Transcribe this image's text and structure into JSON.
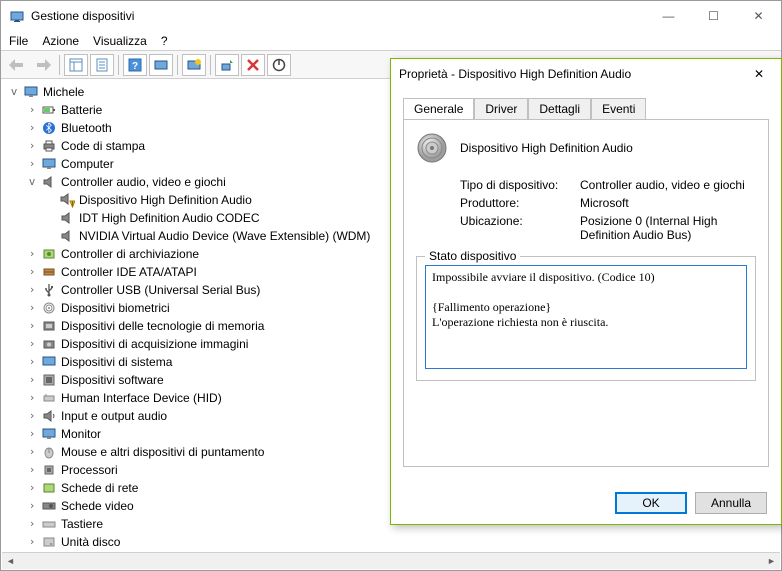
{
  "window": {
    "title": "Gestione dispositivi",
    "minimize": "—",
    "maximize": "☐",
    "close": "✕"
  },
  "menu": {
    "file": "File",
    "azione": "Azione",
    "visualizza": "Visualizza",
    "help": "?"
  },
  "tree": {
    "root": "Michele",
    "batterie": "Batterie",
    "bluetooth": "Bluetooth",
    "code": "Code di stampa",
    "computer": "Computer",
    "controller_audio": "Controller audio, video e giochi",
    "hda": "Dispositivo High Definition Audio",
    "idt": "IDT High Definition Audio CODEC",
    "nvidia": "NVIDIA Virtual Audio Device (Wave Extensible) (WDM)",
    "archiviazione": "Controller di archiviazione",
    "ide": "Controller IDE ATA/ATAPI",
    "usb": "Controller USB (Universal Serial Bus)",
    "biometrici": "Dispositivi biometrici",
    "memoria": "Dispositivi delle tecnologie di memoria",
    "immagini": "Dispositivi di acquisizione immagini",
    "sistema": "Dispositivi di sistema",
    "software": "Dispositivi software",
    "hid": "Human Interface Device (HID)",
    "audio_io": "Input e output audio",
    "monitor": "Monitor",
    "mouse": "Mouse e altri dispositivi di puntamento",
    "processori": "Processori",
    "rete": "Schede di rete",
    "video": "Schede video",
    "tastiere": "Tastiere",
    "disco": "Unità disco"
  },
  "dialog": {
    "title": "Proprietà - Dispositivo High Definition Audio",
    "tabs": {
      "generale": "Generale",
      "driver": "Driver",
      "dettagli": "Dettagli",
      "eventi": "Eventi"
    },
    "device_name": "Dispositivo High Definition Audio",
    "tipo_k": "Tipo di dispositivo:",
    "tipo_v": "Controller audio, video e giochi",
    "prod_k": "Produttore:",
    "prod_v": "Microsoft",
    "ubic_k": "Ubicazione:",
    "ubic_v": "Posizione 0 (Internal High Definition Audio Bus)",
    "status_label": "Stato dispositivo",
    "status_text": "Impossibile avviare il dispositivo. (Codice 10)\n\n{Fallimento operazione}\nL'operazione richiesta non è riuscita.",
    "ok": "OK",
    "cancel": "Annulla"
  }
}
